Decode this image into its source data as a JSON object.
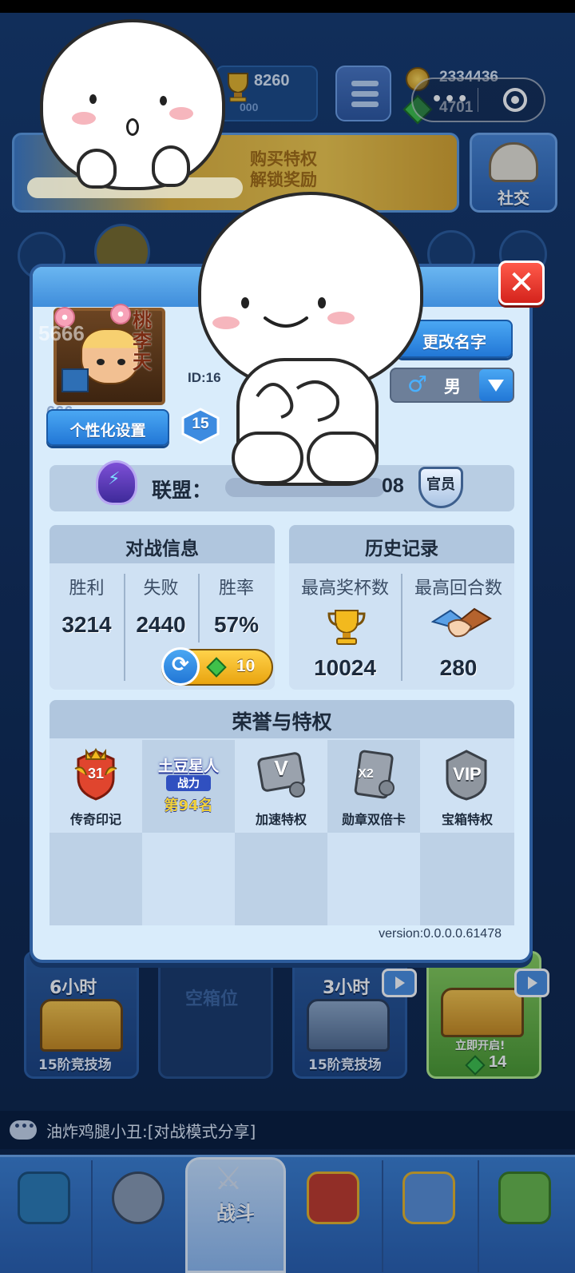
{
  "top": {
    "trophies": "8260",
    "trophies_sub": "000",
    "coins": "2334436",
    "gems": "4701",
    "capsule_dots": "•••"
  },
  "banner": {
    "text": "购买特权\n解锁奖励"
  },
  "social": {
    "label": "社交"
  },
  "profile": {
    "avatar_name": "桃\n李\n天",
    "avatar_wm": "5666",
    "avatar_wm2": "666",
    "id_text": "ID:16",
    "custom_button": "个性化设置",
    "level": "15",
    "rename_button": "更改名字",
    "gender_symbol": "♂",
    "gender": "男",
    "alliance_label": "联盟：",
    "alliance_suffix": "08",
    "officer": "官员"
  },
  "battle_info": {
    "title": "对战信息",
    "wins_label": "胜利",
    "losses_label": "失败",
    "rate_label": "胜率",
    "wins": "3214",
    "losses": "2440",
    "rate": "57%",
    "reset_cost": "10"
  },
  "history": {
    "title": "历史记录",
    "max_trophies_label": "最高奖杯数",
    "max_rounds_label": "最高回合数",
    "max_trophies": "10024",
    "max_rounds": "280"
  },
  "honors": {
    "title": "荣誉与特权",
    "items": [
      {
        "label": "传奇印记",
        "badge": "31"
      },
      {
        "label": "土豆星人",
        "sub": "战力",
        "rank": "第94名"
      },
      {
        "label": "加速特权",
        "icon": "V"
      },
      {
        "label": "勋章双倍卡",
        "icon": "X2"
      },
      {
        "label": "宝箱特权",
        "icon": "VIP"
      }
    ]
  },
  "version": "version:0.0.0.0.61478",
  "chests": [
    {
      "time": "6小时",
      "arena": "15阶竞技场"
    },
    {
      "empty": "空箱位"
    },
    {
      "time": "3小时",
      "arena": "15阶竞技场"
    },
    {
      "open": "立即开启!",
      "gems": "14"
    }
  ],
  "chat": {
    "text": "油炸鸡腿小丑:[对战模式分享]"
  },
  "nav": {
    "battle": "战斗"
  },
  "colors": {
    "dialog_bg": "#d9ecfb",
    "panel_head": "#b0c6de",
    "button_blue": "#2277d6",
    "close_red": "#d4231c",
    "gold": "#f3c94b",
    "background": "#132f5c"
  }
}
